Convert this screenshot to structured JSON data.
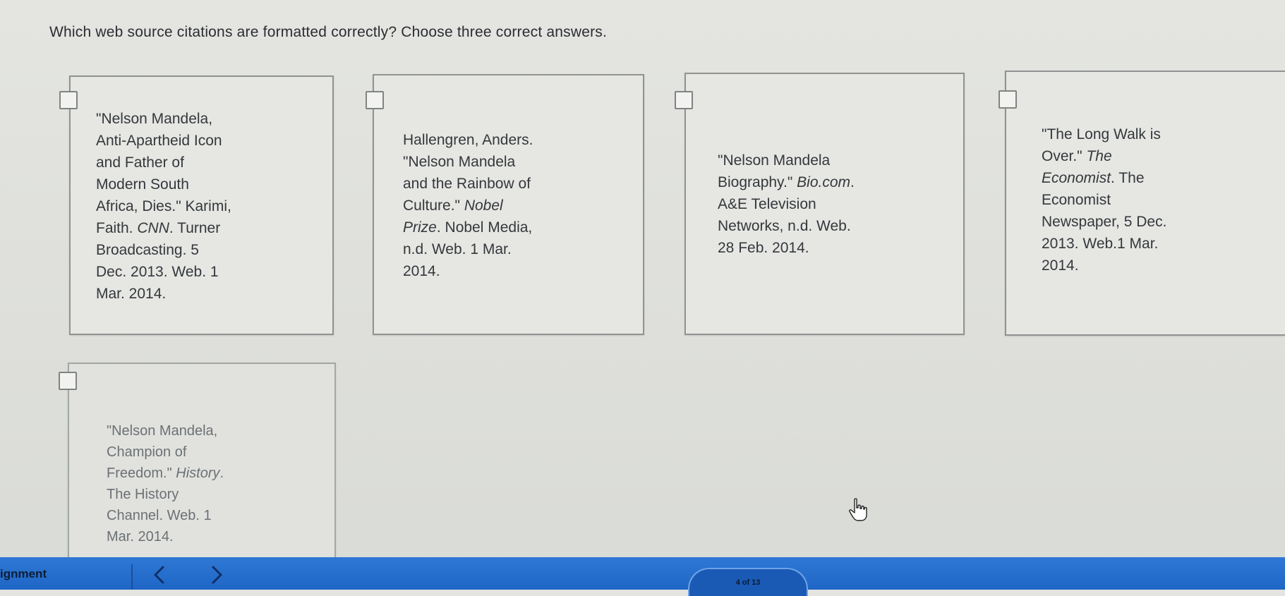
{
  "question": {
    "text": "Which web source citations are formatted correctly? Choose three correct answers."
  },
  "options": [
    {
      "lines": [
        "\"Nelson Mandela,",
        "Anti-Apartheid Icon",
        "and Father of",
        "Modern South",
        "Africa, Dies.\" Karimi,",
        "Faith. CNN. Turner",
        "Broadcasting. 5",
        "Dec. 2013. Web. 1",
        "Mar. 2014."
      ]
    },
    {
      "lines": [
        "Hallengren, Anders.",
        "\"Nelson Mandela",
        "and the Rainbow of",
        "Culture.\" Nobel",
        "Prize. Nobel Media,",
        "n.d. Web. 1 Mar.",
        "2014."
      ]
    },
    {
      "lines": [
        "\"Nelson Mandela",
        "Biography.\" Bio.com.",
        "A&E Television",
        "Networks, n.d. Web.",
        "28 Feb. 2014."
      ]
    },
    {
      "lines": [
        "\"The Long Walk is",
        "Over.\" The",
        "Economist. The",
        "Economist",
        "Newspaper, 5 Dec.",
        "2013. Web.1 Mar.",
        "2014."
      ]
    },
    {
      "lines": [
        "\"Nelson Mandela,",
        "Champion of",
        "Freedom.\" History.",
        "The History",
        "Channel. Web. 1",
        "Mar. 2014."
      ]
    }
  ],
  "bottom_bar": {
    "label": "ignment",
    "progress_text": "4 of 13"
  },
  "icons": {
    "prev": "chevron-left-icon",
    "next": "chevron-right-icon",
    "cursor": "hand-pointer-icon"
  },
  "colors": {
    "bar": "#2372d0",
    "card_border": "#8f9391"
  }
}
